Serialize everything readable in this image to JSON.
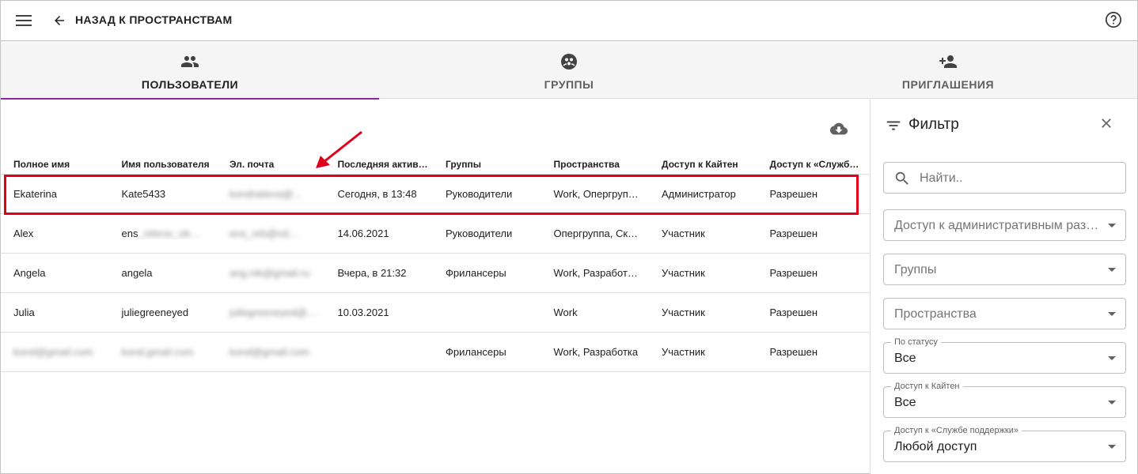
{
  "header": {
    "back_label": "НАЗАД К ПРОСТРАНСТВАМ",
    "menu_icon": "menu-icon",
    "back_icon": "arrow-back-icon",
    "help_icon": "help-icon"
  },
  "tabs": [
    {
      "label": "ПОЛЬЗОВАТЕЛИ",
      "icon": "people-icon",
      "active": true
    },
    {
      "label": "ГРУППЫ",
      "icon": "groups-icon",
      "active": false
    },
    {
      "label": "ПРИГЛАШЕНИЯ",
      "icon": "person-add-icon",
      "active": false
    }
  ],
  "table": {
    "columns": [
      "Полное имя",
      "Имя пользователя",
      "Эл. почта",
      "Последняя актив…",
      "Группы",
      "Пространства",
      "Доступ к Кайтен",
      "Доступ к «Служб…"
    ],
    "rows": [
      [
        "Ekaterina",
        "Kate5433",
        "kondratieva@…",
        "Сегодня, в 13:48",
        "Руководители",
        "Work, Опергруп…",
        "Администратор",
        "Разрешен"
      ],
      [
        "Alex",
        "ens",
        "ens_reb@nd…",
        "14.06.2021",
        "Руководители",
        "Опергруппа, Ск…",
        "Участник",
        "Разрешен"
      ],
      [
        "Angela",
        "angela",
        "ang.nik@gmail.ru",
        "Вчера, в 21:32",
        "Фрилансеры",
        "Work, Разработ…",
        "Участник",
        "Разрешен"
      ],
      [
        "Julia",
        "juliegreeneyed",
        "juliegreeneyed@…",
        "10.03.2021",
        "",
        "Work",
        "Участник",
        "Разрешен"
      ],
      [
        "kond@gmail.com",
        "kond.gmail.com",
        "kond@gmail.com",
        "",
        "Фрилансеры",
        "Work, Разработка",
        "Участник",
        "Разрешен"
      ]
    ],
    "user_suffix": "_rebrov_ob…"
  },
  "filter": {
    "title": "Фильтр",
    "search_placeholder": "Найти..",
    "admin_access_placeholder": "Доступ к административным раз…",
    "groups_placeholder": "Группы",
    "spaces_placeholder": "Пространства",
    "status_label": "По статусу",
    "status_value": "Все",
    "kaiten_label": "Доступ к Кайтен",
    "kaiten_value": "Все",
    "support_label": "Доступ к «Службе поддержки»",
    "support_value": "Любой доступ"
  },
  "colors": {
    "accent": "#8e24aa",
    "highlight": "#e0001a"
  }
}
